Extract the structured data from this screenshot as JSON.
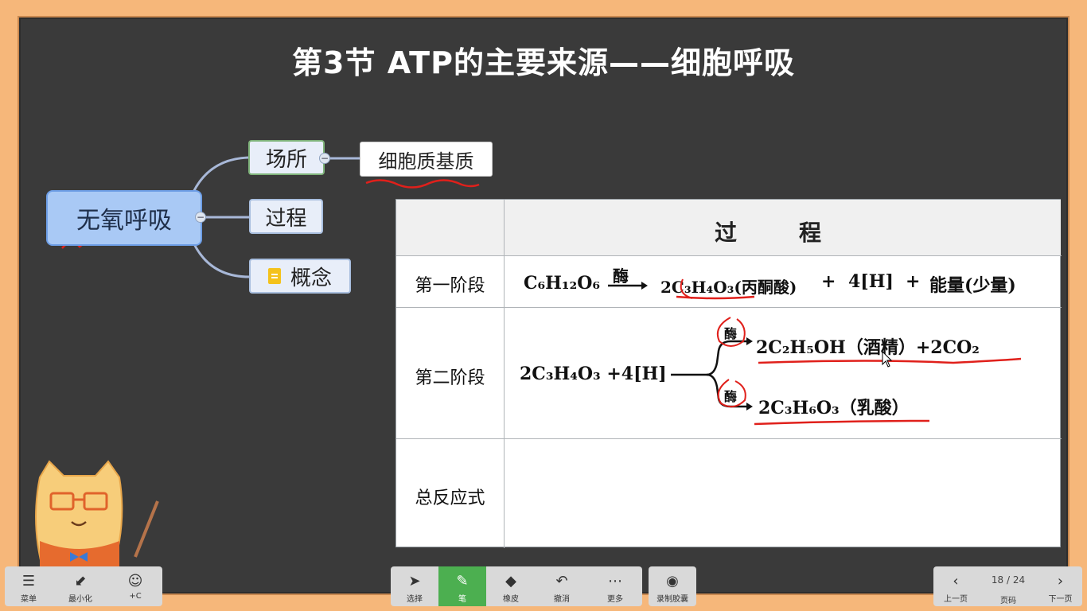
{
  "slide": {
    "title": "第3节  ATP的主要来源——细胞呼吸"
  },
  "mindmap": {
    "root": "无氧呼吸",
    "children": [
      {
        "label": "场所",
        "child": "细胞质基质"
      },
      {
        "label": "过程"
      },
      {
        "label": "概念"
      }
    ]
  },
  "table": {
    "header": "过        程",
    "rows": [
      {
        "label": "第一阶段"
      },
      {
        "label": "第二阶段"
      },
      {
        "label": "总反应式"
      }
    ],
    "stage1": {
      "reactant": "C₆H₁₂O₆",
      "enzyme": "酶",
      "product": "2C₃H₄O₃(丙酮酸)",
      "plus1": "+",
      "h": "4[H]",
      "plus2": "+",
      "energy": "能量(少量)"
    },
    "stage2": {
      "reactant": "2C₃H₄O₃ +4[H]",
      "enzyme_top": "酶",
      "product_top": "2C₂H₅OH（酒精）+2CO₂",
      "enzyme_bottom": "酶",
      "product_bottom": "2C₃H₆O₃（乳酸）"
    }
  },
  "toolbar": {
    "left": [
      {
        "icon": "menu-icon",
        "label": "菜单"
      },
      {
        "icon": "minimize-icon",
        "label": "最小化"
      },
      {
        "icon": "avatar-icon",
        "label": "+C"
      }
    ],
    "center": [
      {
        "icon": "cursor-icon",
        "label": "选择"
      },
      {
        "icon": "pen-icon",
        "label": "笔"
      },
      {
        "icon": "eraser-icon",
        "label": "橡皮"
      },
      {
        "icon": "undo-icon",
        "label": "撤消"
      },
      {
        "icon": "more-icon",
        "label": "更多"
      }
    ],
    "record": {
      "icon": "record-icon",
      "label": "录制胶囊"
    },
    "nav": {
      "prev": "上一页",
      "page": "18 / 24",
      "page_label": "页码",
      "next": "下一页"
    }
  },
  "colors": {
    "board": "#3a3a3a",
    "frame": "#f6b77a",
    "annotation": "#e0201b",
    "pen_active": "#4caf50"
  }
}
